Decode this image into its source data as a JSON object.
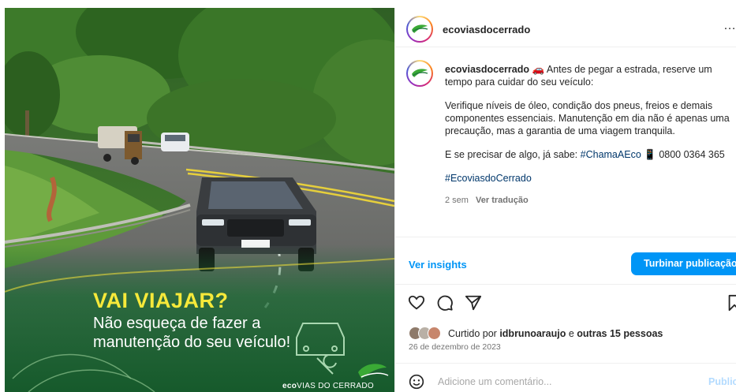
{
  "post": {
    "username": "ecoviasdocerrado",
    "more_icon": "…",
    "caption": {
      "username": "ecoviasdocerrado",
      "car_emoji": "🚗",
      "intro": "Antes de pegar a estrada, reserve um tempo para cuidar do seu veículo:",
      "paragraph": "Verifique níveis de óleo, condição dos pneus, freios e demais componentes essenciais. Manutenção em dia não é apenas uma precaução, mas a garantia de uma viagem tranquila.",
      "contact_prefix": "E se precisar de algo, já sabe:",
      "contact_hashtag": "#ChamaAEco",
      "phone_emoji": "📱",
      "phone": "0800 0364 365",
      "hashtag": "#EcoviasdoCerrado"
    },
    "time_ago": "2 sem",
    "translate": "Ver tradução",
    "insights_label": "Ver insights",
    "boost_label": "Turbinar publicação",
    "likes": {
      "prefix": "Curtido por",
      "user": "idbrunoaraujo",
      "connector": "e",
      "others": "outras 15 pessoas"
    },
    "date": "26 de dezembro de 2023",
    "comment_placeholder": "Adicione um comentário...",
    "publish_label": "Publicar"
  },
  "image": {
    "headline": "VAI VIAJAR?",
    "line1": "Não esqueça de fazer a",
    "line2": "manutenção do seu veículo!",
    "brand_strong": "eco",
    "brand_rest": "VIAS DO CERRADO"
  },
  "colors": {
    "accent": "#0095f6",
    "headline": "#f6e93a",
    "brand_green": "#3aa935",
    "overlay_green": "#1f7a3c"
  }
}
